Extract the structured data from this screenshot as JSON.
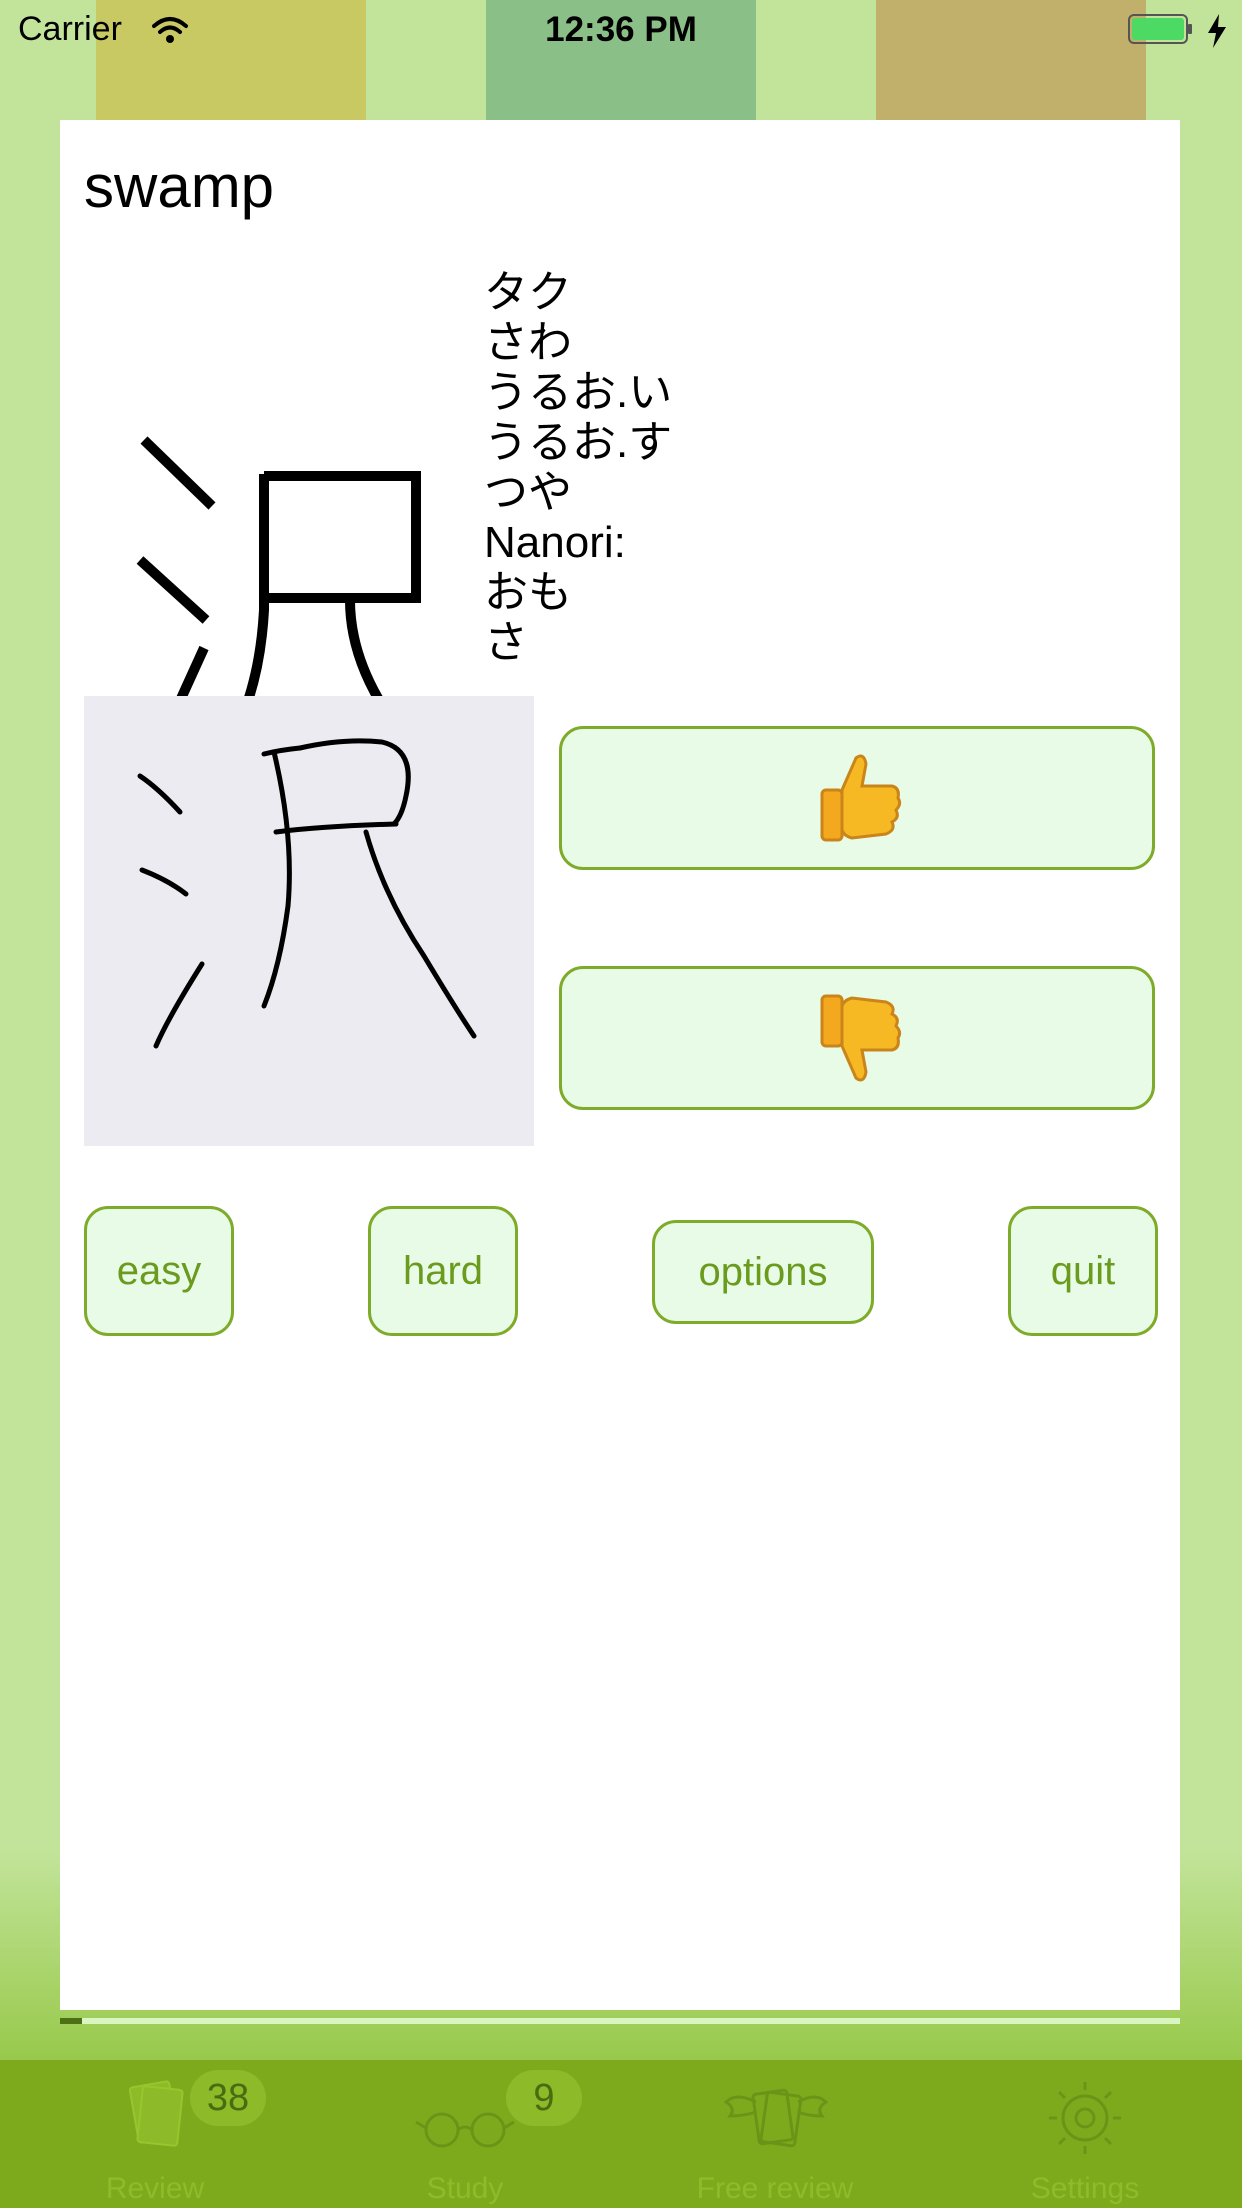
{
  "status_bar": {
    "carrier": "Carrier",
    "time": "12:36 PM"
  },
  "card": {
    "word": "swamp",
    "kanji": "沢",
    "readings": [
      "タク",
      "さわ",
      "うるお.い",
      "うるお.す",
      "つや",
      "Nanori:",
      "おも",
      "さ"
    ]
  },
  "vote": {
    "up_icon": "thumbs-up-icon",
    "down_icon": "thumbs-down-icon"
  },
  "buttons": {
    "easy": "easy",
    "hard": "hard",
    "options": "options",
    "quit": "quit"
  },
  "progress": {
    "fraction": 0.02
  },
  "tabs": [
    {
      "label": "Review",
      "icon": "cards-icon",
      "badge": "38"
    },
    {
      "label": "Study",
      "icon": "glasses-icon",
      "badge": "9"
    },
    {
      "label": "Free review",
      "icon": "winged-cards-icon",
      "badge": ""
    },
    {
      "label": "Settings",
      "icon": "gear-icon",
      "badge": ""
    }
  ],
  "colors": {
    "accent": "#7fab2b",
    "button_fill": "#e8fbe6",
    "tabbar": "#7daa1c",
    "background": "#c2e49a"
  }
}
